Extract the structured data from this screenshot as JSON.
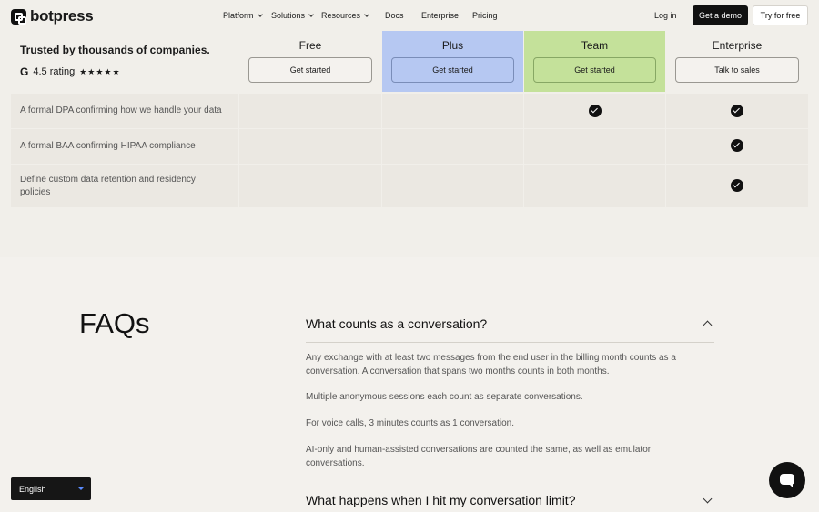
{
  "nav": {
    "logo_text": "botpress",
    "items": [
      "Platform",
      "Solutions",
      "Resources",
      "Docs",
      "Enterprise",
      "Pricing"
    ],
    "login": "Log in",
    "demo": "Get a demo",
    "try": "Try for free"
  },
  "pricing": {
    "trusted": "Trusted by thousands of companies.",
    "rating": "4.5 rating",
    "stars": "★★★★★",
    "plans": [
      {
        "name": "Free",
        "cta": "Get started",
        "color": "#f1efea"
      },
      {
        "name": "Plus",
        "cta": "Get started",
        "color": "#b6c8f2"
      },
      {
        "name": "Team",
        "cta": "Get started",
        "color": "#c4e19a"
      },
      {
        "name": "Enterprise",
        "cta": "Talk to sales",
        "color": "#f1efea"
      }
    ],
    "rows": [
      {
        "feature": "A formal DPA confirming how we handle your data",
        "checks": [
          false,
          false,
          true,
          true
        ]
      },
      {
        "feature": "A formal BAA confirming HIPAA compliance",
        "checks": [
          false,
          false,
          false,
          true
        ]
      },
      {
        "feature": "Define custom data retention and residency policies",
        "checks": [
          false,
          false,
          false,
          true
        ]
      }
    ]
  },
  "faq": {
    "title": "FAQs",
    "q1": "What counts as a conversation?",
    "answers": [
      "Any exchange with at least two messages from the end user in the billing month counts as a conversation. A conversation that spans two months counts in both months.",
      "Multiple anonymous sessions each count as separate conversations.",
      "For voice calls, 3 minutes counts as 1 conversation.",
      "AI-only and human-assisted conversations are counted the same, as well as emulator conversations."
    ],
    "q2": "What happens when I hit my conversation limit?"
  },
  "language": "English"
}
